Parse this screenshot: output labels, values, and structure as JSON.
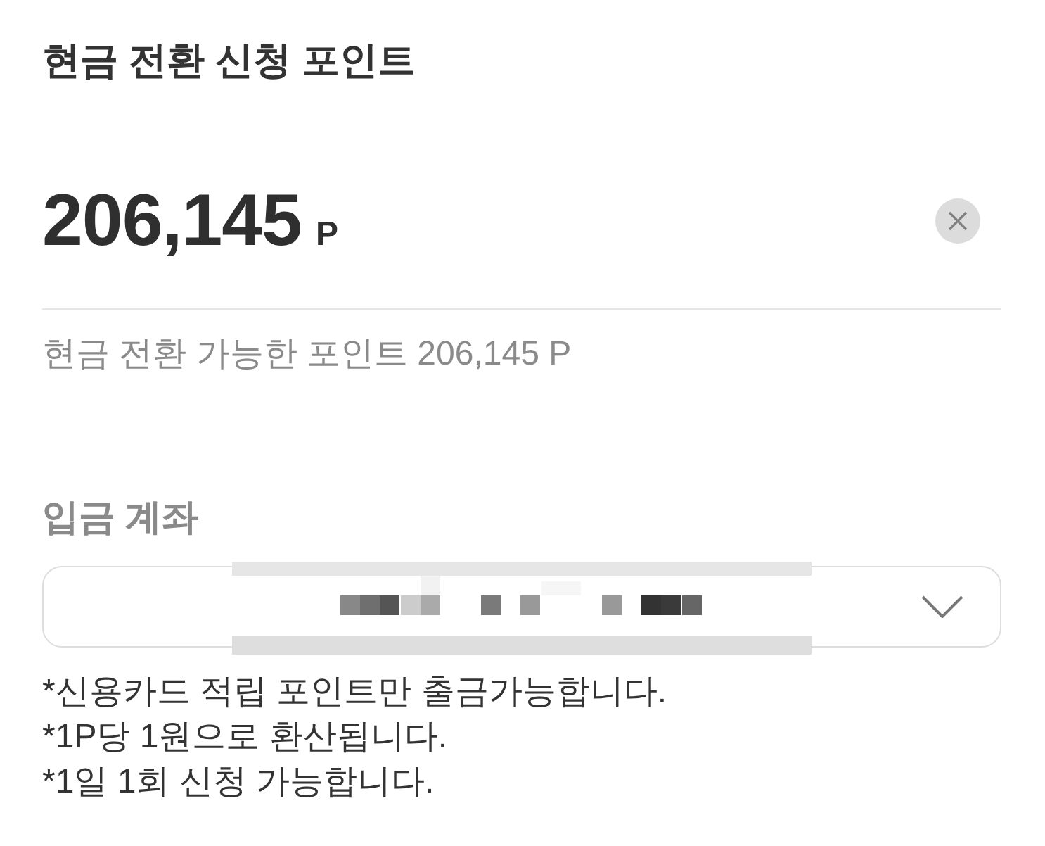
{
  "title": "현금 전환 신청 포인트",
  "amount": {
    "value": "206,145",
    "unit": "P"
  },
  "available": "현금 전환 가능한 포인트 206,145 P",
  "account": {
    "label": "입금 계좌"
  },
  "notes": [
    "*신용카드 적립 포인트만 출금가능합니다.",
    "*1P당 1원으로 환산됩니다.",
    "*1일 1회 신청 가능합니다."
  ]
}
